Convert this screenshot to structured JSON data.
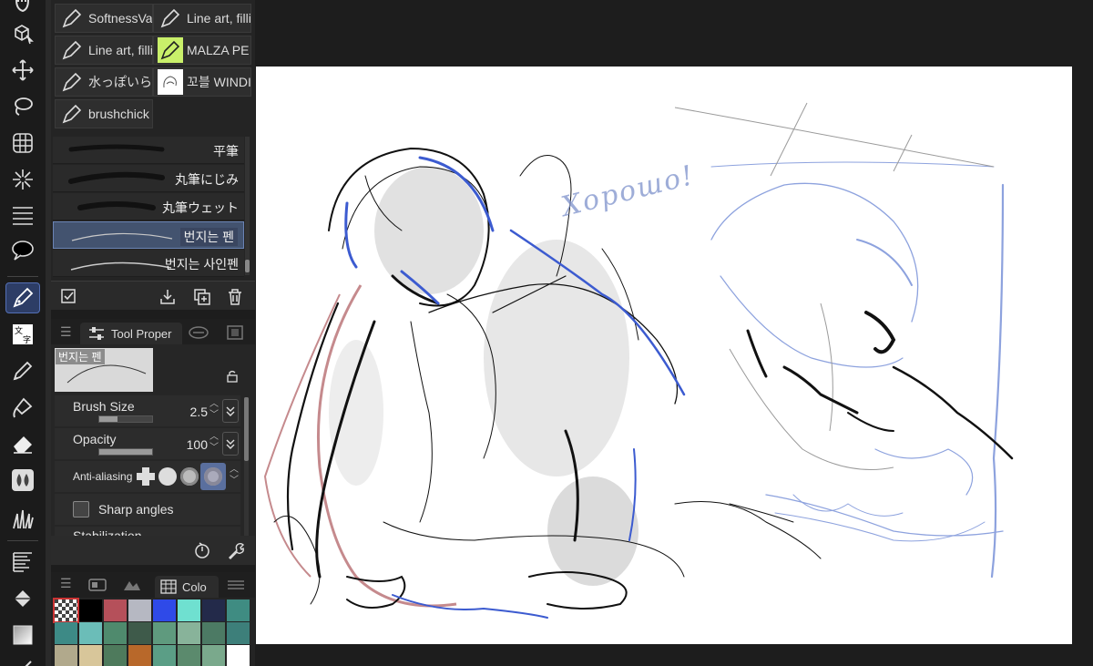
{
  "toolbar": {
    "tools": [
      {
        "name": "hand-icon"
      },
      {
        "name": "3d-operation-icon"
      },
      {
        "name": "move-icon"
      },
      {
        "name": "lasso-selection-icon"
      },
      {
        "name": "mesh-grid-icon"
      },
      {
        "name": "magic-wand-icon"
      },
      {
        "name": "ruler-lines-icon"
      },
      {
        "name": "speech-balloon-icon"
      },
      {
        "name": "pen-tool-icon",
        "active": true
      },
      {
        "name": "text-tool-icon",
        "label": "文字"
      },
      {
        "name": "pencil-tool-icon"
      },
      {
        "name": "brush-tool-icon"
      },
      {
        "name": "eraser-icon"
      },
      {
        "name": "blend-tool-icon"
      },
      {
        "name": "decoration-tool-icon"
      },
      {
        "name": "gradient-tool-icon"
      },
      {
        "name": "fill-bucket-icon"
      },
      {
        "name": "figure-tool-icon"
      }
    ]
  },
  "subtool": {
    "cells": [
      {
        "label": "SoftnessVa",
        "icon": "pen-nib-icon"
      },
      {
        "label": "Line art, filli",
        "icon": "pen-nib-icon"
      },
      {
        "label": "Line art, filli",
        "icon": "pen-nib-icon"
      },
      {
        "label": "MALZA PE",
        "icon": "pen-nib-green-icon"
      },
      {
        "label": "水っぽいら",
        "icon": "pen-nib-icon"
      },
      {
        "label": "꼬블 WINDI",
        "icon": "sketch-thumbnail-icon"
      },
      {
        "label": "brushchick",
        "icon": "pen-nib-icon"
      }
    ],
    "brushes": [
      {
        "label": "平筆"
      },
      {
        "label": "丸筆にじみ"
      },
      {
        "label": "丸筆ウェット"
      },
      {
        "label": "번지는 펜",
        "selected": true
      },
      {
        "label": "번지는 사인펜"
      }
    ]
  },
  "toolprop": {
    "tab_label": "Tool Proper",
    "preview_label": "번지는 펜",
    "brush_size": {
      "label": "Brush Size",
      "value": "2.5",
      "fill": 0.35
    },
    "opacity": {
      "label": "Opacity",
      "value": "100",
      "fill": 1.0
    },
    "anti_aliasing": {
      "label": "Anti-aliasing",
      "selected_index": 3
    },
    "sharp_angles": {
      "label": "Sharp angles",
      "checked": false
    },
    "stabilization": {
      "label": "Stabilization"
    }
  },
  "colorset": {
    "tab_label": "Colo",
    "swatches": [
      "transparent",
      "#000000",
      "#b5505a",
      "#b6b8c2",
      "#2f4ae8",
      "#6fe0d0",
      "#232a4a",
      "#3f8c82",
      "#3d8a86",
      "#6bbdb8",
      "#4f8a6d",
      "#3e5a4a",
      "#5f9a7e",
      "#88b39a",
      "#4c7a64",
      "#3d7f7a",
      "#b1a98c",
      "#d8c69a",
      "#4e7a5c",
      "#b8682a",
      "#5b9e86",
      "#5b8a6d",
      "#7aa98c",
      "#ffffff"
    ]
  },
  "canvas": {
    "handwritten_text": "Хорошо!"
  }
}
